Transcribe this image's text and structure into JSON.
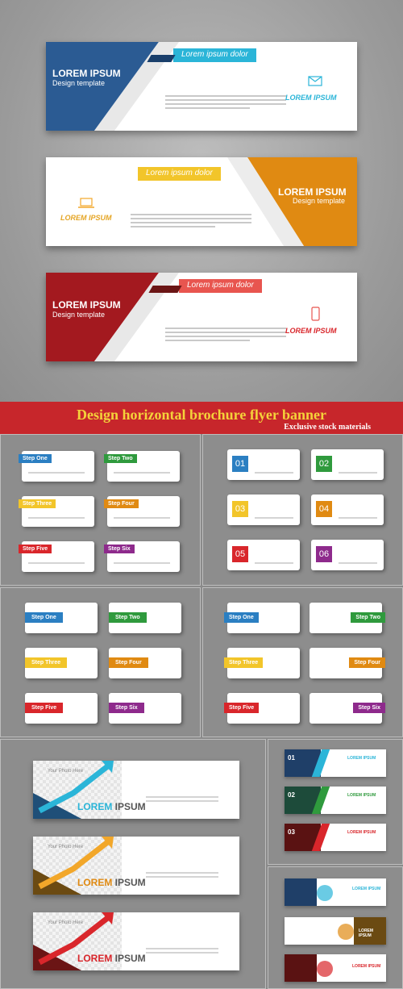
{
  "colors": {
    "blue": "#2b5b93",
    "orange": "#e08a12",
    "red": "#a3191f",
    "cyan": "#2bb5d8",
    "yellow": "#f2c52a",
    "green": "#2f9a3d",
    "purple": "#8e2a8c",
    "darkred": "#6b1515"
  },
  "top_banners": [
    {
      "title": "LOREM IPSUM",
      "subtitle": "Design template",
      "ribbon": "Lorem ipsum dolor",
      "brand": "LOREM IPSUM",
      "icon": "envelope-icon",
      "color": "#2b5b93"
    },
    {
      "title": "LOREM IPSUM",
      "subtitle": "Design template",
      "ribbon": "Lorem ipsum dolor",
      "brand": "LOREM IPSUM",
      "icon": "laptop-icon",
      "color": "#e08a12"
    },
    {
      "title": "LOREM IPSUM",
      "subtitle": "Design template",
      "ribbon": "Lorem ipsum dolor",
      "brand": "LOREM IPSUM",
      "icon": "phone-icon",
      "color": "#a3191f"
    }
  ],
  "title_bar": {
    "title": "Design horizontal brochure flyer banner",
    "subtitle": "Exclusive stock materials"
  },
  "steps": [
    "Step One",
    "Step Two",
    "Step Three",
    "Step Four",
    "Step Five",
    "Step Six"
  ],
  "numbers": [
    "01",
    "02",
    "03",
    "04",
    "05",
    "06"
  ],
  "photo_banners": [
    {
      "photo_text": "Your Photo Here",
      "lorem_a": "LOREM",
      "lorem_b": " IPSUM",
      "color": "#2bb5d8"
    },
    {
      "photo_text": "Your Photo Here",
      "lorem_a": "LOREM",
      "lorem_b": " IPSUM",
      "color": "#f2a72a"
    },
    {
      "photo_text": "Your Photo Here",
      "lorem_a": "LOREM",
      "lorem_b": " IPSUM",
      "color": "#d9262b"
    }
  ],
  "small_banners": [
    {
      "num": "01",
      "brand": "LOREM IPSUM"
    },
    {
      "num": "02",
      "brand": "LOREM IPSUM"
    },
    {
      "num": "03",
      "brand": "LOREM IPSUM"
    }
  ],
  "splash_banners": [
    {
      "brand": "LOREM IPSUM"
    },
    {
      "brand": "LOREM IPSUM"
    },
    {
      "brand": "LOREM IPSUM"
    }
  ]
}
